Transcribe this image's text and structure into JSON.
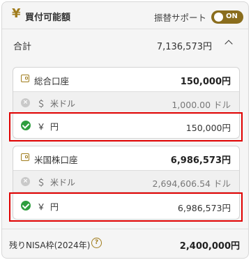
{
  "header": {
    "icon": "yen-icon",
    "title": "買付可能額",
    "support_label": "振替サポート",
    "toggle_label": "ON",
    "toggle_state": "on"
  },
  "total": {
    "label": "合計",
    "value": "7,136,573円"
  },
  "accounts": [
    {
      "icon": "wallet-icon",
      "name": "総合口座",
      "amount": "150,000円",
      "usd": {
        "symbol": "＄",
        "name": "米ドル",
        "amount": "1,000.00 ドル",
        "status_icon": "x-circle-icon"
      },
      "jpy": {
        "symbol": "￥",
        "name": "円",
        "amount": "150,000円",
        "status_icon": "check-circle-icon"
      }
    },
    {
      "icon": "wallet-icon",
      "name": "米国株口座",
      "amount": "6,986,573円",
      "usd": {
        "symbol": "＄",
        "name": "米ドル",
        "amount": "2,694,606.54 ドル",
        "status_icon": "x-circle-icon"
      },
      "jpy": {
        "symbol": "￥",
        "name": "円",
        "amount": "6,986,573円",
        "status_icon": "check-circle-icon"
      }
    }
  ],
  "nisa": {
    "label": "残りNISA枠(2024年)",
    "value": "2,400,000円",
    "help_icon": "?"
  },
  "colors": {
    "accent": "#a07c1c",
    "toggle_bg": "#8a6d1d",
    "check": "#2e9e3e",
    "highlight": "#e00000"
  }
}
